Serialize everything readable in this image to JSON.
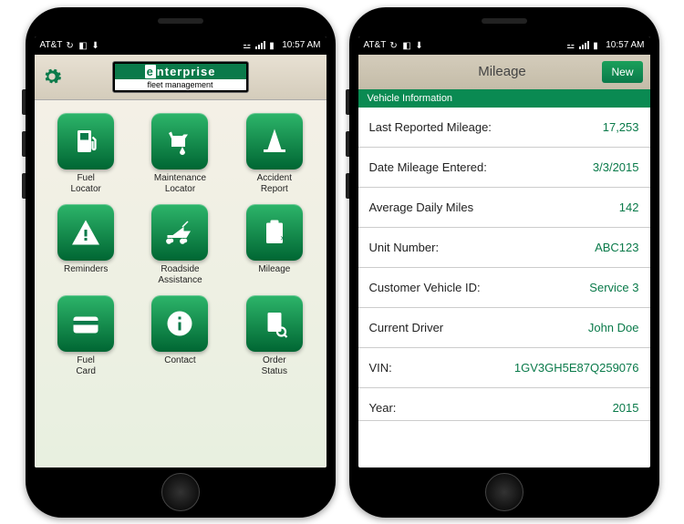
{
  "status_bar": {
    "carrier": "AT&T",
    "time": "10:57 AM"
  },
  "phone1": {
    "brand_top": "nterprise",
    "brand_e": "e",
    "brand_bottom": "fleet management",
    "tiles": [
      {
        "label": "Fuel Locator",
        "icon": "fuel"
      },
      {
        "label": "Maintenance Locator",
        "icon": "oil"
      },
      {
        "label": "Accident Report",
        "icon": "cone"
      },
      {
        "label": "Reminders",
        "icon": "warn"
      },
      {
        "label": "Roadside Assistance",
        "icon": "tow"
      },
      {
        "label": "Mileage",
        "icon": "clip"
      },
      {
        "label": "Fuel Card",
        "icon": "card"
      },
      {
        "label": "Contact",
        "icon": "info"
      },
      {
        "label": "Order Status",
        "icon": "status"
      }
    ]
  },
  "phone2": {
    "title": "Mileage",
    "new_btn": "New",
    "section": "Vehicle Information",
    "rows": [
      {
        "label": "Last Reported Mileage:",
        "value": "17,253"
      },
      {
        "label": "Date Mileage Entered:",
        "value": "3/3/2015"
      },
      {
        "label": "Average Daily Miles",
        "value": "142"
      },
      {
        "label": "Unit Number:",
        "value": "ABC123"
      },
      {
        "label": "Customer Vehicle ID:",
        "value": "Service 3"
      },
      {
        "label": "Current Driver",
        "value": "John Doe"
      },
      {
        "label": "VIN:",
        "value": "1GV3GH5E87Q259076"
      },
      {
        "label": "Year:",
        "value": "2015"
      }
    ]
  }
}
